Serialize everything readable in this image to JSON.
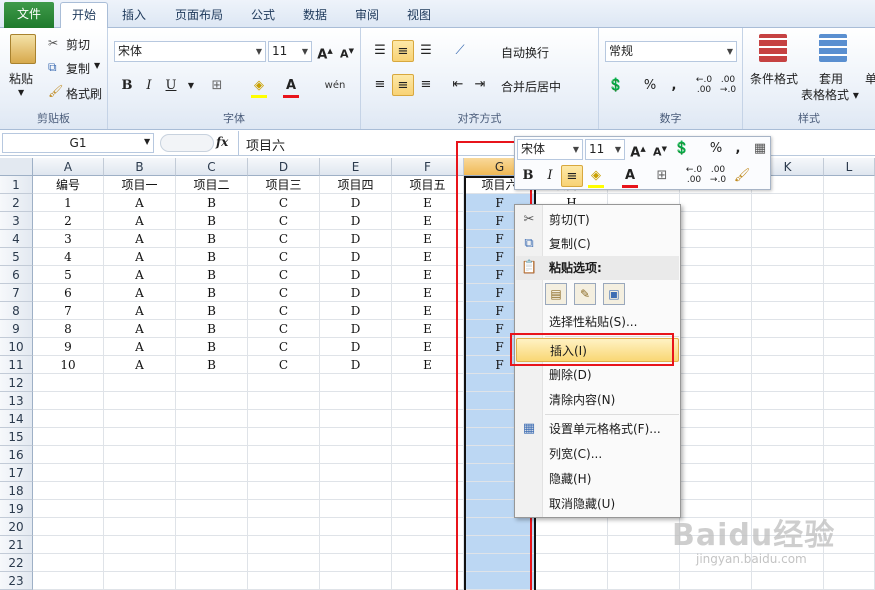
{
  "tabs": [
    "文件",
    "开始",
    "插入",
    "页面布局",
    "公式",
    "数据",
    "审阅",
    "视图"
  ],
  "clipboard": {
    "paste": "粘贴",
    "cut": "剪切",
    "copy": "复制",
    "format_painter": "格式刷",
    "label": "剪贴板"
  },
  "font": {
    "name": "宋体",
    "size": "11",
    "bold": "B",
    "italic": "I",
    "underline": "U",
    "label": "字体"
  },
  "alignment": {
    "wrap": "自动换行",
    "merge": "合并后居中",
    "label": "对齐方式"
  },
  "number": {
    "format": "常规",
    "percent": "%",
    "comma": ",",
    "inc_dec": "←.0\n.00",
    "dec_dec": ".00\n→.0",
    "label": "数字"
  },
  "styles": {
    "cond": "条件格式",
    "table_fmt": "套用\n表格格式",
    "cell": "单",
    "label": "样式"
  },
  "formula_bar": {
    "name_box": "G1",
    "fx": "fx",
    "content": "项目六"
  },
  "columns": [
    "A",
    "B",
    "C",
    "D",
    "E",
    "F",
    "G",
    "H",
    "I",
    "J",
    "K",
    "L"
  ],
  "rows": [
    "1",
    "2",
    "3",
    "4",
    "5",
    "6",
    "7",
    "8",
    "9",
    "10",
    "11",
    "12",
    "13",
    "14",
    "15",
    "16",
    "17",
    "18",
    "19",
    "20",
    "21",
    "22",
    "23"
  ],
  "headers": [
    "编号",
    "项目一",
    "项目二",
    "项目三",
    "项目四",
    "项目五",
    "项目六"
  ],
  "h_col_partial": [
    "项目八",
    "H"
  ],
  "data": [
    [
      "1",
      "A",
      "B",
      "C",
      "D",
      "E",
      "F"
    ],
    [
      "2",
      "A",
      "B",
      "C",
      "D",
      "E",
      "F"
    ],
    [
      "3",
      "A",
      "B",
      "C",
      "D",
      "E",
      "F"
    ],
    [
      "4",
      "A",
      "B",
      "C",
      "D",
      "E",
      "F"
    ],
    [
      "5",
      "A",
      "B",
      "C",
      "D",
      "E",
      "F"
    ],
    [
      "6",
      "A",
      "B",
      "C",
      "D",
      "E",
      "F"
    ],
    [
      "7",
      "A",
      "B",
      "C",
      "D",
      "E",
      "F"
    ],
    [
      "8",
      "A",
      "B",
      "C",
      "D",
      "E",
      "F"
    ],
    [
      "9",
      "A",
      "B",
      "C",
      "D",
      "E",
      "F"
    ],
    [
      "10",
      "A",
      "B",
      "C",
      "D",
      "E",
      "F"
    ]
  ],
  "mini_toolbar": {
    "font": "宋体",
    "size": "11",
    "percent": "%",
    "comma": ","
  },
  "context_menu": {
    "cut": "剪切(T)",
    "copy": "复制(C)",
    "paste_options": "粘贴选项:",
    "paste_special": "选择性粘贴(S)...",
    "insert": "插入(I)",
    "delete": "删除(D)",
    "clear": "清除内容(N)",
    "format_cells": "设置单元格格式(F)...",
    "col_width": "列宽(C)...",
    "hide": "隐藏(H)",
    "unhide": "取消隐藏(U)"
  },
  "watermark": {
    "brand": "Baidu经验",
    "url": "jingyan.baidu.com"
  },
  "colors": {
    "selection": "#bcd7f3",
    "highlight_red": "#e8141b",
    "accent_green": "#1f7a2c"
  }
}
